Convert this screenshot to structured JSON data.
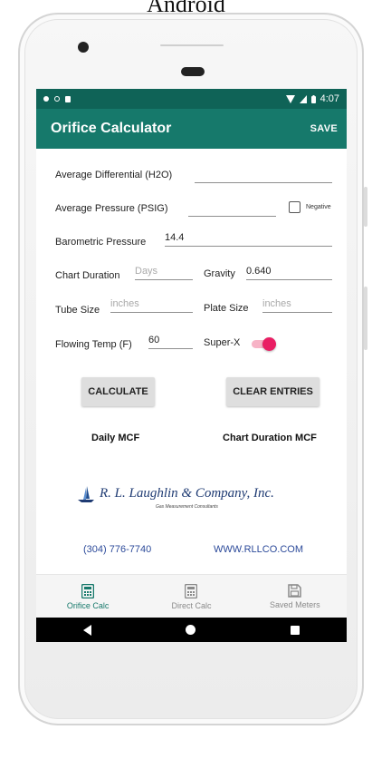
{
  "caption": "Android",
  "status_bar": {
    "time": "4:07"
  },
  "app_bar": {
    "title": "Orifice Calculator",
    "action": "SAVE"
  },
  "form": {
    "avg_differential": {
      "label": "Average Differential (H2O)",
      "value": ""
    },
    "avg_pressure": {
      "label": "Average Pressure (PSIG)",
      "value": "",
      "checkbox_label": "Negative",
      "checked": false
    },
    "barometric": {
      "label": "Barometric Pressure",
      "value": "14.4"
    },
    "chart_duration": {
      "label": "Chart Duration",
      "placeholder": "Days"
    },
    "gravity": {
      "label": "Gravity",
      "value": "0.640"
    },
    "tube_size": {
      "label": "Tube Size",
      "placeholder": "inches"
    },
    "plate_size": {
      "label": "Plate Size",
      "placeholder": "inches"
    },
    "flowing_temp": {
      "label": "Flowing Temp (F)",
      "value": "60"
    },
    "super_x": {
      "label": "Super-X",
      "on": true
    }
  },
  "buttons": {
    "calculate": "CALCULATE",
    "clear": "CLEAR ENTRIES"
  },
  "results": {
    "daily": "Daily MCF",
    "chart_duration": "Chart Duration MCF"
  },
  "company": {
    "name": "R. L. Laughlin & Company, Inc.",
    "subtitle": "Gas Measurement Consultants",
    "phone": "(304) 776-7740",
    "website": "WWW.RLLCO.COM"
  },
  "bottom_nav": [
    {
      "label": "Orifice Calc",
      "icon": "calculator-icon",
      "active": true
    },
    {
      "label": "Direct Calc",
      "icon": "calculator-icon",
      "active": false
    },
    {
      "label": "Saved Meters",
      "icon": "save-icon",
      "active": false
    }
  ],
  "colors": {
    "primary": "#16796b",
    "primary_dark": "#0f6357",
    "accent": "#e91e63"
  }
}
